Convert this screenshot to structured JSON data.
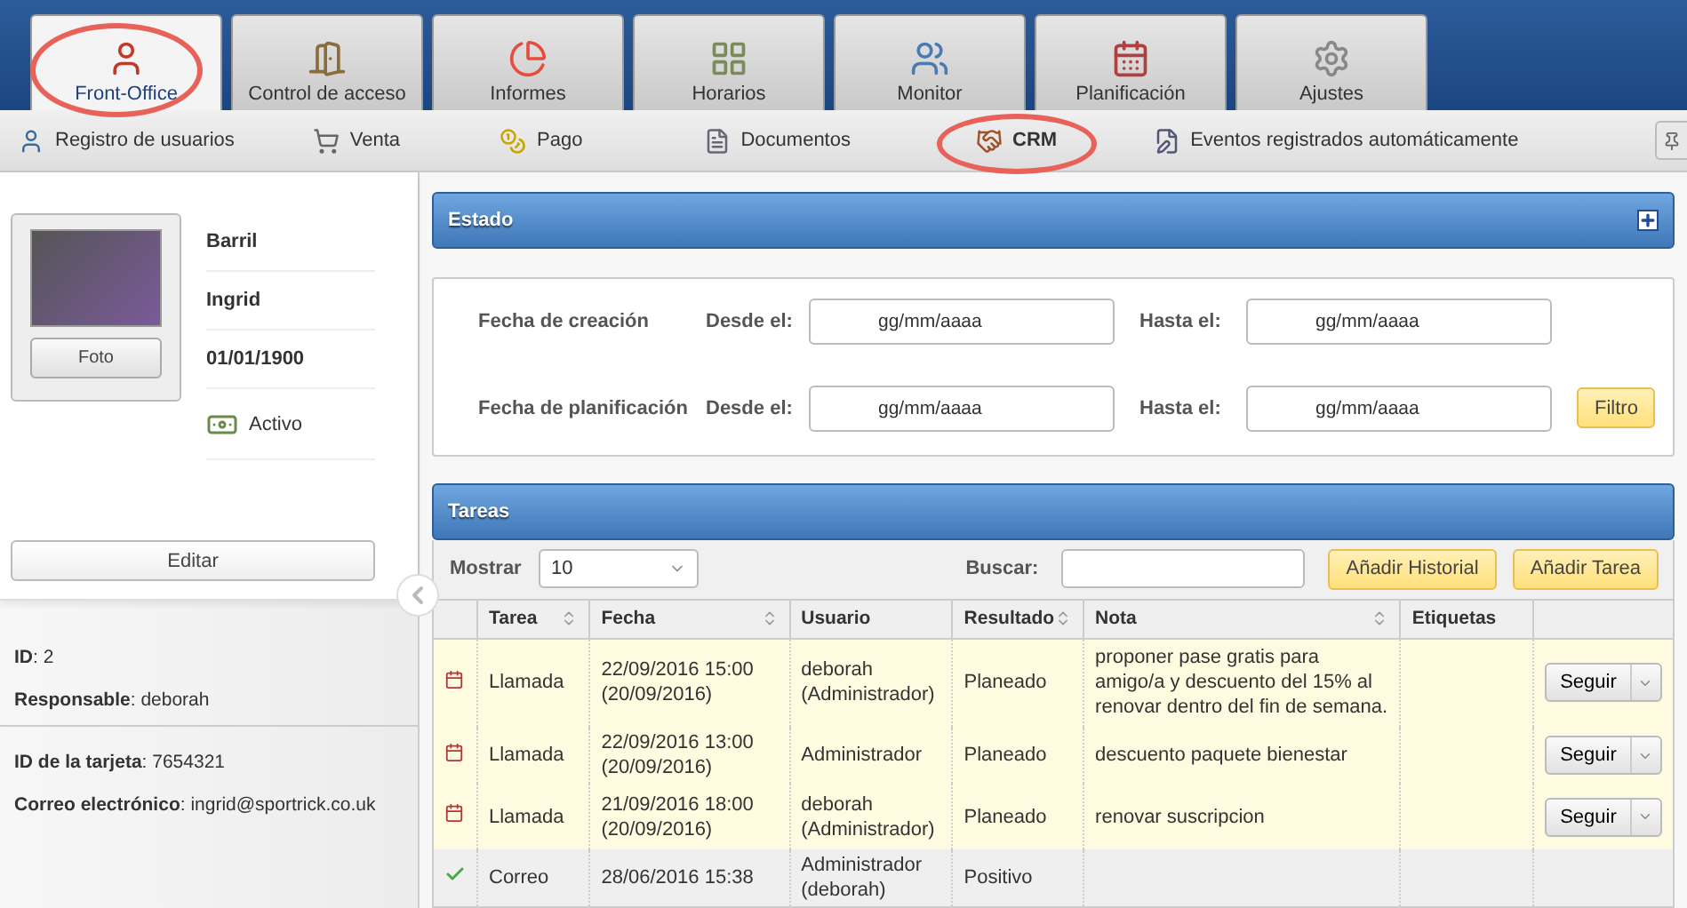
{
  "tabs": [
    {
      "label": "Front-Office",
      "selected": true,
      "circled": true
    },
    {
      "label": "Control de acceso",
      "selected": false,
      "circled": false
    },
    {
      "label": "Informes",
      "selected": false,
      "circled": false
    },
    {
      "label": "Horarios",
      "selected": false,
      "circled": false
    },
    {
      "label": "Monitor",
      "selected": false,
      "circled": false
    },
    {
      "label": "Planificación",
      "selected": false,
      "circled": false
    },
    {
      "label": "Ajustes",
      "selected": false,
      "circled": false
    }
  ],
  "subnav": [
    {
      "label": "Registro de usuarios",
      "selected": false,
      "circled": false
    },
    {
      "label": "Venta",
      "selected": false,
      "circled": false
    },
    {
      "label": "Pago",
      "selected": false,
      "circled": false
    },
    {
      "label": "Documentos",
      "selected": false,
      "circled": false
    },
    {
      "label": "CRM",
      "selected": true,
      "circled": true
    },
    {
      "label": "Eventos registrados automáticamente",
      "selected": false,
      "circled": false
    }
  ],
  "profile": {
    "photo_button": "Foto",
    "fields": [
      "Barril",
      "Ingrid",
      "01/01/1900"
    ],
    "status": "Activo",
    "edit_button": "Editar"
  },
  "details": [
    [
      "**ID**: 2",
      "**Responsable**: deborah"
    ],
    [
      "**ID de la tarjeta**: 7654321",
      "**Correo electrónico**: ingrid@sportrick.co.uk"
    ]
  ],
  "estado": {
    "title": "Estado",
    "filters": [
      {
        "label": "Fecha de creación",
        "from_label": "Desde el:",
        "from_placeholder": "gg/mm/aaaa",
        "to_label": "Hasta el:",
        "to_placeholder": "gg/mm/aaaa"
      },
      {
        "label": "Fecha de planificación",
        "from_label": "Desde el:",
        "from_placeholder": "gg/mm/aaaa",
        "to_label": "Hasta el:",
        "to_placeholder": "gg/mm/aaaa"
      }
    ],
    "filter_button": "Filtro"
  },
  "tareas": {
    "title": "Tareas",
    "show_label": "Mostrar",
    "show_value": "10",
    "search_label": "Buscar:",
    "buttons": [
      "Añadir Historial",
      "Añadir Tarea"
    ],
    "columns": [
      {
        "label": "Tarea",
        "sortable": true
      },
      {
        "label": "Fecha",
        "sortable": true
      },
      {
        "label": "Usuario",
        "sortable": false
      },
      {
        "label": "Resultado",
        "sortable": true
      },
      {
        "label": "Nota",
        "sortable": true
      },
      {
        "label": "Etiquetas",
        "sortable": false
      }
    ],
    "rows": [
      {
        "kind": "pending",
        "cells": [
          "Llamada",
          "22/09/2016 15:00 (20/09/2016)",
          "deborah (Administrador)",
          "Planeado",
          "proponer pase gratis para amigo/a y descuento del 15% al renovar dentro del fin de semana."
        ],
        "action": "Seguir"
      },
      {
        "kind": "pending",
        "cells": [
          "Llamada",
          "22/09/2016 13:00 (20/09/2016)",
          "Administrador",
          "Planeado",
          "descuento paquete bienestar"
        ],
        "action": "Seguir"
      },
      {
        "kind": "pending",
        "cells": [
          "Llamada",
          "21/09/2016 18:00 (20/09/2016)",
          "deborah (Administrador)",
          "Planeado",
          "renovar suscripcion"
        ],
        "action": "Seguir"
      },
      {
        "kind": "done",
        "cells": [
          "Correo",
          "28/06/2016 15:38",
          "Administrador (deborah)",
          "Positivo"
        ]
      }
    ]
  }
}
